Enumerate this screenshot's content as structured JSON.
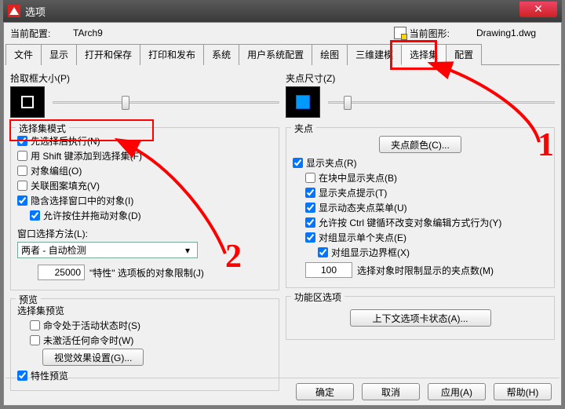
{
  "window": {
    "title": "选项",
    "close": "✕"
  },
  "profile": {
    "label": "当前配置:",
    "value": "TArch9",
    "right_label": "当前图形:",
    "right_value": "Drawing1.dwg"
  },
  "tabs": [
    "文件",
    "显示",
    "打开和保存",
    "打印和发布",
    "系统",
    "用户系统配置",
    "绘图",
    "三维建模",
    "选择集",
    "配置"
  ],
  "active_tab": "选择集",
  "left": {
    "pickbox": "拾取框大小(P)",
    "mode_legend": "选择集模式",
    "mode": {
      "noun_verb": "先选择后执行(N)",
      "shift_add": "用 Shift 键添加到选择集(F)",
      "obj_group": "对象编组(O)",
      "assoc_hatch": "关联图案填充(V)",
      "implied_win": "隐含选择窗口中的对象(I)",
      "press_drag": "允许按住并拖动对象(D)"
    },
    "window_method_label": "窗口选择方法(L):",
    "window_method_value": "两者 - 自动检测",
    "props_limit_value": "25000",
    "props_limit_label": "\"特性\" 选项板的对象限制(J)",
    "preview_legend": "预览",
    "preview_sub": "选择集预览",
    "cmd_active": "命令处于活动状态时(S)",
    "no_cmd": "未激活任何命令时(W)",
    "visual_btn": "视觉效果设置(G)...",
    "prop_preview": "特性预览"
  },
  "right": {
    "grip_size": "夹点尺寸(Z)",
    "grips_legend": "夹点",
    "grip_color_btn": "夹点颜色(C)...",
    "show_grips": "显示夹点(R)",
    "grips_blocks": "在块中显示夹点(B)",
    "grip_tips": "显示夹点提示(T)",
    "dyn_grip_menu": "显示动态夹点菜单(U)",
    "ctrl_cycle": "允许按 Ctrl 键循环改变对象编辑方式行为(Y)",
    "group_single": "对组显示单个夹点(E)",
    "group_bbox": "对组显示边界框(X)",
    "grip_limit_value": "100",
    "grip_limit_label": "选择对象时限制显示的夹点数(M)",
    "ribbon_legend": "功能区选项",
    "ribbon_btn": "上下文选项卡状态(A)..."
  },
  "footer": {
    "ok": "确定",
    "cancel": "取消",
    "apply": "应用(A)",
    "help": "帮助(H)"
  },
  "anno": {
    "one": "1",
    "two": "2"
  }
}
